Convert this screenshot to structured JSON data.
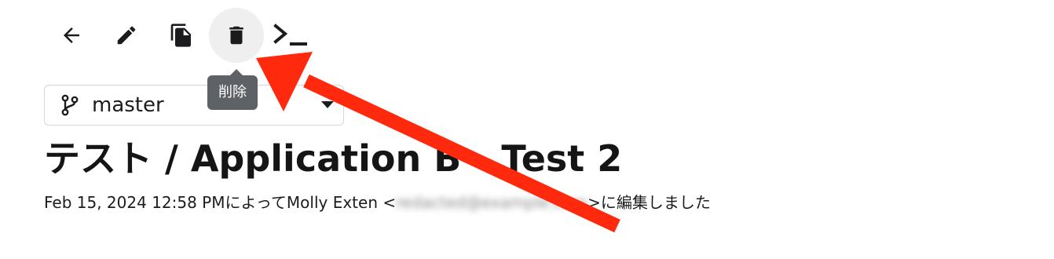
{
  "toolbar": {
    "buttons": [
      {
        "name": "back",
        "icon": "arrow-left-icon"
      },
      {
        "name": "edit",
        "icon": "pencil-icon"
      },
      {
        "name": "duplicate",
        "icon": "copy-icon"
      },
      {
        "name": "delete",
        "icon": "trash-icon"
      },
      {
        "name": "terminal",
        "icon": "terminal-icon"
      }
    ],
    "hovered": "delete",
    "tooltip": "削除"
  },
  "branch_select": {
    "icon": "git-branch-icon",
    "value": "master"
  },
  "page": {
    "title": "テスト / Application B - Test 2",
    "edited_prefix": "Feb 15, 2024 12:58 PMによってMolly Exten <",
    "edited_email": "redacted@example.com",
    "edited_suffix": ">に編集しました"
  },
  "colors": {
    "annotation_arrow": "#ff2a0e",
    "tooltip_bg": "#5e6166",
    "hover_bg": "#efefef"
  }
}
